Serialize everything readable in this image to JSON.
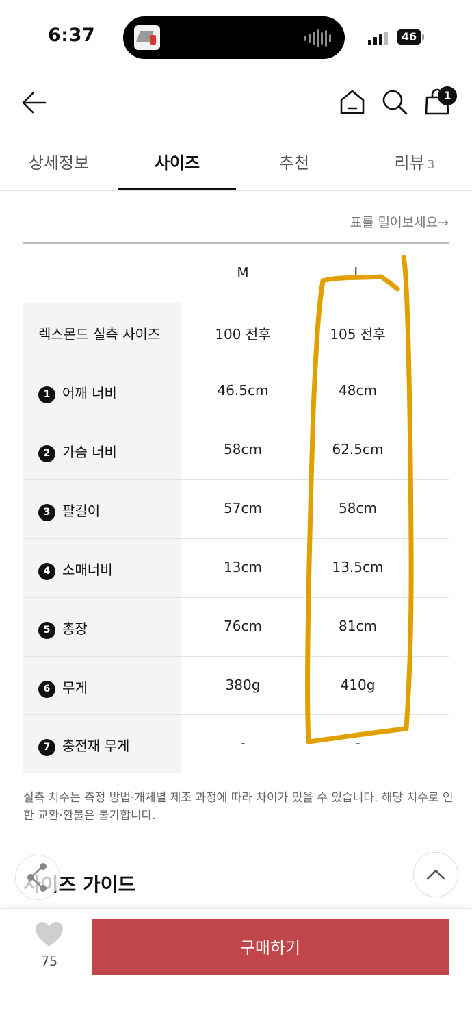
{
  "status_bar": {
    "time": "6:37",
    "battery": "46"
  },
  "header": {
    "cart_count": "1"
  },
  "tabs": [
    {
      "label": "상세정보"
    },
    {
      "label": "사이즈"
    },
    {
      "label": "추천"
    },
    {
      "label": "리뷰",
      "count": "3"
    }
  ],
  "active_tab": "사이즈",
  "table_hint": "표를 밀어보세요→",
  "size_table": {
    "columns": [
      "M",
      "L"
    ],
    "rows": [
      {
        "label": "렉스몬드 실측 사이즈",
        "num": "",
        "values": [
          "100 전후",
          "105 전후"
        ]
      },
      {
        "label": "어깨 너비",
        "num": "1",
        "values": [
          "46.5cm",
          "48cm"
        ]
      },
      {
        "label": "가슴 너비",
        "num": "2",
        "values": [
          "58cm",
          "62.5cm"
        ]
      },
      {
        "label": "팔길이",
        "num": "3",
        "values": [
          "57cm",
          "58cm"
        ]
      },
      {
        "label": "소매너비",
        "num": "4",
        "values": [
          "13cm",
          "13.5cm"
        ]
      },
      {
        "label": "총장",
        "num": "5",
        "values": [
          "76cm",
          "81cm"
        ]
      },
      {
        "label": "무게",
        "num": "6",
        "values": [
          "380g",
          "410g"
        ]
      },
      {
        "label": "충전재 무게",
        "num": "7",
        "values": [
          "-",
          "-"
        ]
      }
    ]
  },
  "note": "실측 치수는 측정 방법·개체별 제조 과정에 따라 차이가 있을 수 있습니다. 해당 치수로 인한 교환·환불은 불가합니다.",
  "size_guide_title": "사이즈 가이드",
  "bottom_bar": {
    "like_count": "75",
    "buy_label": "구매하기"
  },
  "colors": {
    "buy_button": "#c0464b",
    "annotation": "#e0a000",
    "label_bg": "#f4f4f4"
  }
}
